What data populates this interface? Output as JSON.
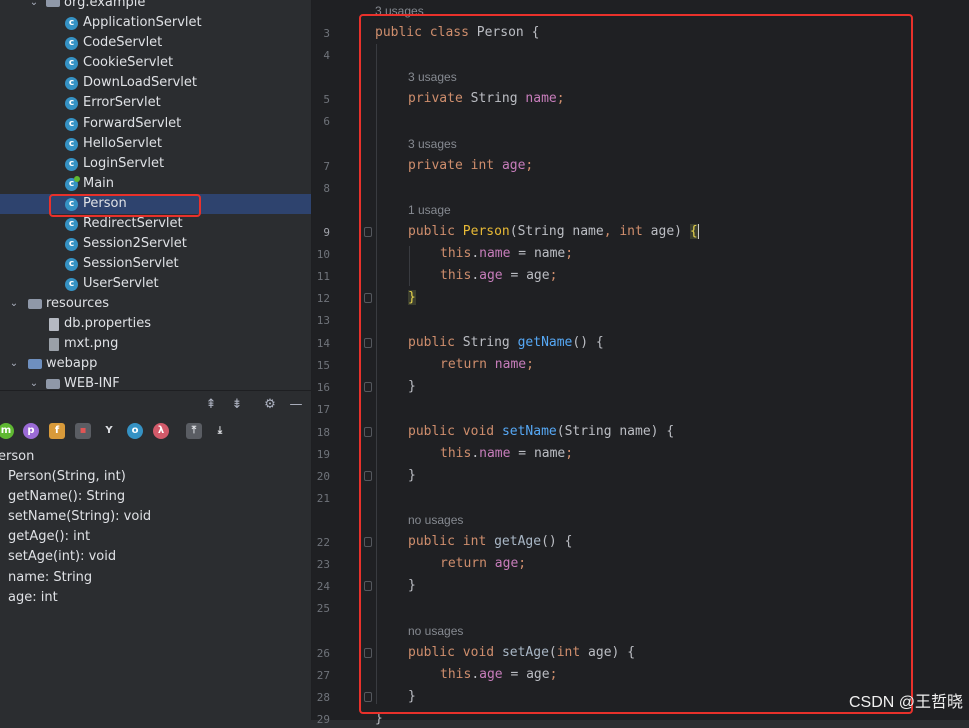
{
  "project_tree": {
    "package": "org.example",
    "classes": [
      "ApplicationServlet",
      "CodeServlet",
      "CookieServlet",
      "DownLoadServlet",
      "ErrorServlet",
      "ForwardServlet",
      "HelloServlet",
      "LoginServlet",
      "Main",
      "Person",
      "RedirectServlet",
      "Session2Servlet",
      "SessionServlet",
      "UserServlet"
    ],
    "class_icon_letter": "c",
    "resources_folder": "resources",
    "resource_files": [
      "db.properties",
      "mxt.png"
    ],
    "webapp_folder": "webapp",
    "webinf_folder": "WEB-INF"
  },
  "structure_toolbar": {
    "filter_icons": [
      "m",
      "p",
      "f",
      "lock",
      "fork",
      "o",
      "λ"
    ]
  },
  "structure": {
    "class_name": "erson",
    "members": [
      "Person(String, int)",
      "getName(): String",
      "setName(String): void",
      "getAge(): int",
      "setAge(int): void",
      "name: String",
      "age: int"
    ]
  },
  "editor": {
    "top_usage_hint": "3 usages",
    "line_numbers": [
      "3",
      "4",
      "5",
      "6",
      "7",
      "8",
      "9",
      "10",
      "11",
      "12",
      "13",
      "14",
      "15",
      "16",
      "17",
      "18",
      "19",
      "20",
      "21",
      "22",
      "23",
      "24",
      "25",
      "26",
      "27",
      "28",
      "29"
    ],
    "current_line": "9",
    "hints": {
      "name_usages": "3 usages",
      "age_usages": "3 usages",
      "ctor_usage": "1 usage",
      "getage_usage": "no usages",
      "setage_usage": "no usages"
    },
    "tokens": {
      "public": "public",
      "class": "class",
      "private": "private",
      "int": "int",
      "this": "this",
      "return": "return",
      "void": "void",
      "Person": "Person",
      "String": "String",
      "name": "name",
      "age": "age",
      "getName": "getName",
      "setName": "setName",
      "getAge": "getAge",
      "setAge": "setAge",
      "open_brace": "{",
      "close_brace": "}",
      "semicolon": ";",
      "eq": " = ",
      "dot": ".",
      "lparen": "(",
      "rparen": ")",
      "comma": ", ",
      "sp": " "
    }
  },
  "watermark": "CSDN @王哲晓",
  "colors": {
    "highlight_box": "#e8312b",
    "selection": "#2e436e"
  }
}
